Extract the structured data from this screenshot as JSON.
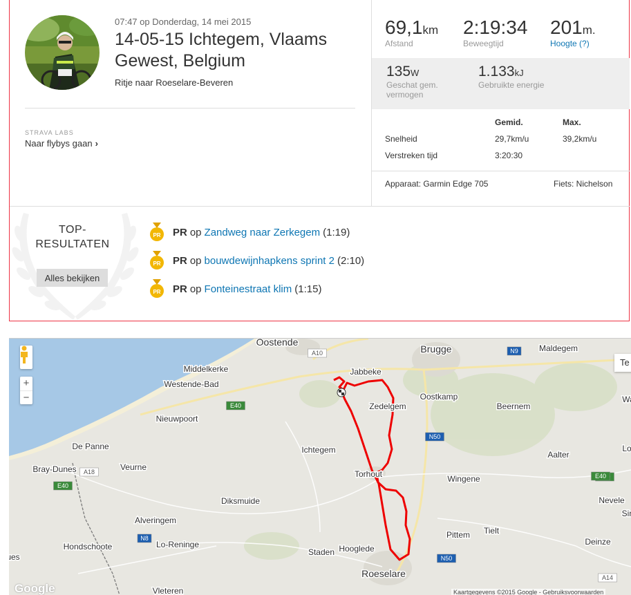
{
  "activity": {
    "datetime": "07:47 op Donderdag, 14 mei 2015",
    "title": "14-05-15 Ichtegem, Vlaams Gewest, Belgium",
    "subtitle": "Ritje naar Roeselare-Beveren"
  },
  "labs": {
    "label": "STRAVA LABS",
    "link": "Naar flybys gaan"
  },
  "stats": {
    "distance": {
      "value": "69,1",
      "unit": "km",
      "label": "Afstand"
    },
    "moving_time": {
      "value": "2:19:34",
      "label": "Beweegtijd"
    },
    "elevation": {
      "value": "201",
      "unit": "m.",
      "label": "Hoogte (?)"
    },
    "power": {
      "value": "135",
      "unit": "W",
      "label": "Geschat gem. vermogen"
    },
    "energy": {
      "value": "1.133",
      "unit": "kJ",
      "label": "Gebruikte energie"
    }
  },
  "table": {
    "col_avg": "Gemid.",
    "col_max": "Max.",
    "rows": [
      {
        "label": "Snelheid",
        "avg": "29,7km/u",
        "max": "39,2km/u"
      },
      {
        "label": "Verstreken tijd",
        "avg": "3:20:30",
        "max": ""
      }
    ]
  },
  "device": {
    "device_text": "Apparaat: Garmin Edge 705",
    "bike_text": "Fiets: Nichelson"
  },
  "top_results": {
    "title": "TOP-\nRESULTATEN",
    "button": "Alles bekijken",
    "items": [
      {
        "badge": "PR",
        "pr": "PR",
        "op": "op",
        "segment": "Zandweg naar Zerkegem",
        "time": "(1:19)"
      },
      {
        "badge": "PR",
        "pr": "PR",
        "op": "op",
        "segment": "bouwdewijnhapkens sprint 2",
        "time": "(2:10)"
      },
      {
        "badge": "PR",
        "pr": "PR",
        "op": "op",
        "segment": "Fonteinestraat klim",
        "time": "(1:15)"
      }
    ]
  },
  "map": {
    "zoom_in": "+",
    "zoom_out": "−",
    "map_type": "Te",
    "logo": "Google",
    "attribution": "Kaartgegevens ©2015 Google - Gebruiksvoorwaarden",
    "places": [
      "Oostende",
      "Brugge",
      "Maldegem",
      "Middelkerke",
      "Jabbeke",
      "Westende-Bad",
      "Zedelgem",
      "Oostkamp",
      "Beernem",
      "Nieuwpoort",
      "Ichtegem",
      "Aalter",
      "De Panne",
      "Torhout",
      "Veurne",
      "Wingene",
      "Bray-Dunes",
      "Diksmuide",
      "Nevele",
      "Alveringem",
      "Tielt",
      "Pittem",
      "Deinze",
      "Hondschoote",
      "Lo-Reninge",
      "Staden",
      "Hooglede",
      "Roeselare",
      "Vleteren",
      "ues",
      "Wa",
      "Lo",
      "Sir"
    ],
    "roads": [
      "A10",
      "N9",
      "E40",
      "E40",
      "N50",
      "A18",
      "E40",
      "N8",
      "N50",
      "E40",
      "A14"
    ]
  }
}
